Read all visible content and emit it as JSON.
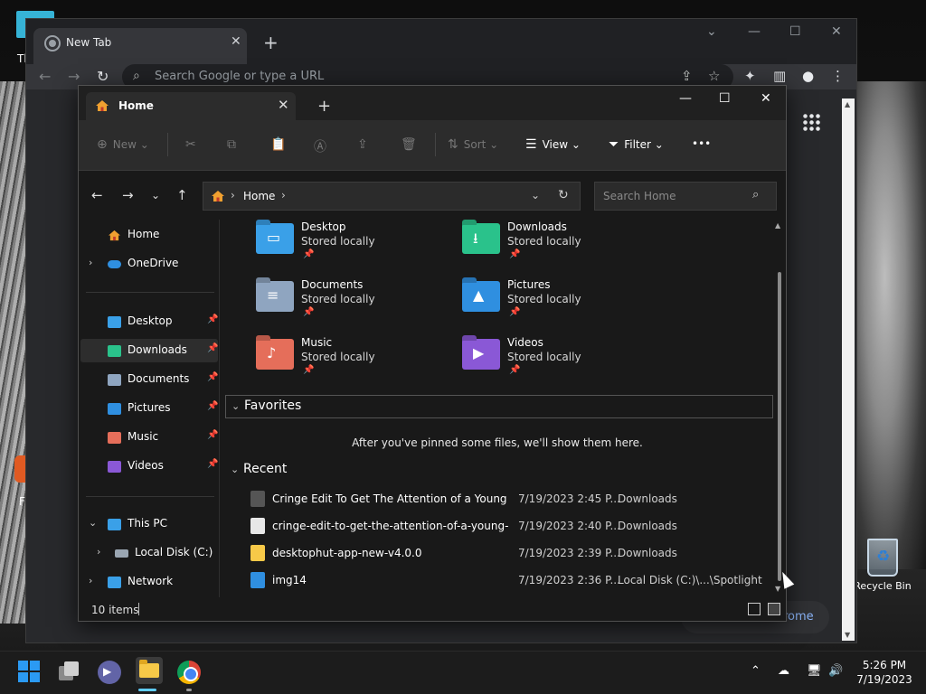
{
  "desktop": {
    "recycle_bin_label": "Recycle Bin",
    "partial_label_top": "Th",
    "partial_label_mid": "F"
  },
  "chrome": {
    "tab_title": "New Tab",
    "omnibox_placeholder": "Search Google or type a URL",
    "pill_text": "rome"
  },
  "explorer": {
    "tab_title": "Home",
    "commands": {
      "new": "New",
      "sort": "Sort",
      "view": "View",
      "filter": "Filter",
      "more": "•••"
    },
    "address": {
      "crumb": "Home"
    },
    "search_placeholder": "Search Home",
    "nav": {
      "home": "Home",
      "onedrive": "OneDrive",
      "quick": [
        {
          "label": "Desktop",
          "icon": "desktop-folder-icon",
          "color": "#3aa0e8"
        },
        {
          "label": "Downloads",
          "icon": "downloads-folder-icon",
          "color": "#2ac28b"
        },
        {
          "label": "Documents",
          "icon": "documents-folder-icon",
          "color": "#8fa5c0"
        },
        {
          "label": "Pictures",
          "icon": "pictures-folder-icon",
          "color": "#2f8fe0"
        },
        {
          "label": "Music",
          "icon": "music-folder-icon",
          "color": "#e56e5a"
        },
        {
          "label": "Videos",
          "icon": "videos-folder-icon",
          "color": "#8a58d6"
        }
      ],
      "this_pc": "This PC",
      "local_disk": "Local Disk (C:)",
      "network": "Network"
    },
    "quick_access": [
      {
        "name": "Desktop",
        "status": "Stored locally",
        "color": "#3aa0e8",
        "symbol": "▭"
      },
      {
        "name": "Downloads",
        "status": "Stored locally",
        "color": "#2ac28b",
        "symbol": "⭳"
      },
      {
        "name": "Documents",
        "status": "Stored locally",
        "color": "#8fa5c0",
        "symbol": "≡"
      },
      {
        "name": "Pictures",
        "status": "Stored locally",
        "color": "#2f8fe0",
        "symbol": "▲"
      },
      {
        "name": "Music",
        "status": "Stored locally",
        "color": "#e56e5a",
        "symbol": "♪"
      },
      {
        "name": "Videos",
        "status": "Stored locally",
        "color": "#8a58d6",
        "symbol": "▶"
      }
    ],
    "favorites": {
      "heading": "Favorites",
      "empty_message": "After you've pinned some files, we'll show them here."
    },
    "recent": {
      "heading": "Recent",
      "rows": [
        {
          "name": "Cringe Edit To Get The Attention of a Young Au...",
          "date": "7/19/2023 2:45 P...",
          "location": "Downloads"
        },
        {
          "name": "cringe-edit-to-get-the-attention-of-a-young-a...",
          "date": "7/19/2023 2:40 P...",
          "location": "Downloads"
        },
        {
          "name": "desktophut-app-new-v4.0.0",
          "date": "7/19/2023 2:39 P...",
          "location": "Downloads"
        },
        {
          "name": "img14",
          "date": "7/19/2023 2:36 P...",
          "location": "Local Disk (C:)\\...\\Spotlight"
        }
      ]
    },
    "status": {
      "item_count": "10 items"
    }
  },
  "taskbar": {
    "time": "5:26 PM",
    "date": "7/19/2023"
  }
}
